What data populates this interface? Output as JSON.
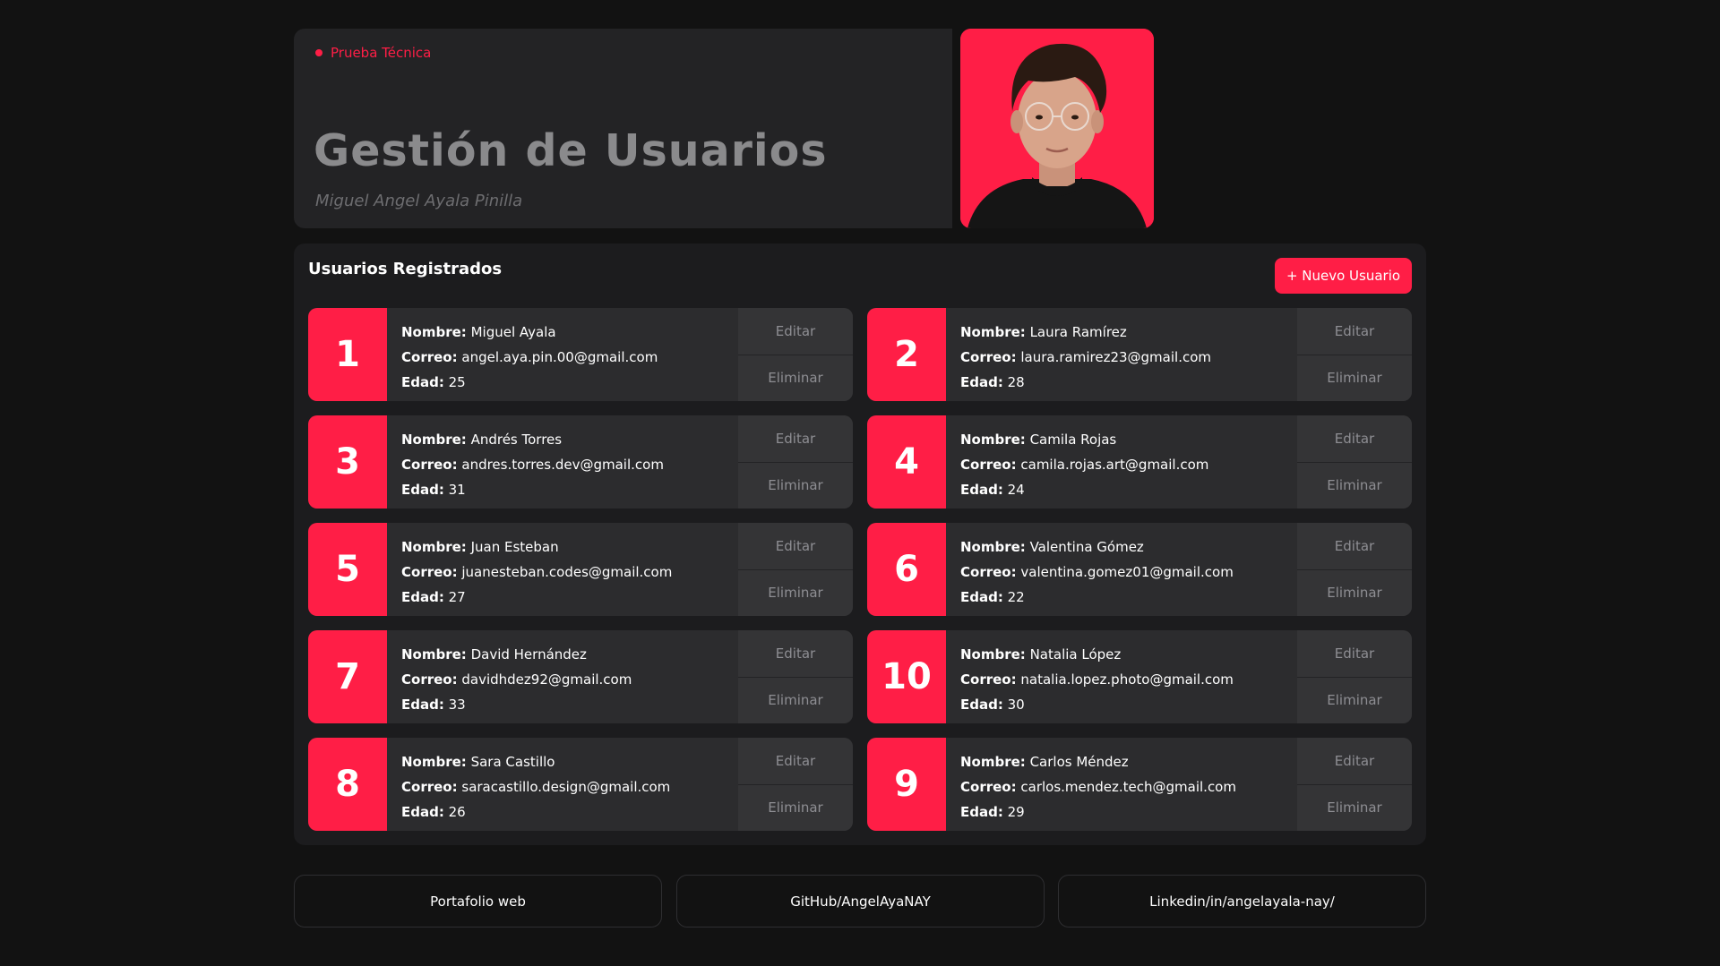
{
  "header": {
    "tag": "Prueba Técnica",
    "title": "Gestión de Usuarios",
    "author": "Miguel Angel Ayala Pinilla"
  },
  "panel": {
    "title": "Usuarios Registrados",
    "new_user_label": "+ Nuevo Usuario"
  },
  "labels": {
    "name": "Nombre:",
    "email": "Correo:",
    "age": "Edad:",
    "edit": "Editar",
    "delete": "Eliminar"
  },
  "users": [
    {
      "num": "1",
      "name": "Miguel Ayala",
      "email": "angel.aya.pin.00@gmail.com",
      "age": "25"
    },
    {
      "num": "2",
      "name": "Laura Ramírez",
      "email": "laura.ramirez23@gmail.com",
      "age": "28"
    },
    {
      "num": "3",
      "name": "Andrés Torres",
      "email": "andres.torres.dev@gmail.com",
      "age": "31"
    },
    {
      "num": "4",
      "name": "Camila Rojas",
      "email": "camila.rojas.art@gmail.com",
      "age": "24"
    },
    {
      "num": "5",
      "name": "Juan Esteban",
      "email": "juanesteban.codes@gmail.com",
      "age": "27"
    },
    {
      "num": "6",
      "name": "Valentina Gómez",
      "email": "valentina.gomez01@gmail.com",
      "age": "22"
    },
    {
      "num": "7",
      "name": "David Hernández",
      "email": "davidhdez92@gmail.com",
      "age": "33"
    },
    {
      "num": "10",
      "name": "Natalia López",
      "email": "natalia.lopez.photo@gmail.com",
      "age": "30"
    },
    {
      "num": "8",
      "name": "Sara Castillo",
      "email": "saracastillo.design@gmail.com",
      "age": "26"
    },
    {
      "num": "9",
      "name": "Carlos Méndez",
      "email": "carlos.mendez.tech@gmail.com",
      "age": "29"
    }
  ],
  "footer": {
    "links": [
      "Portafolio web",
      "GitHub/AngelAyaNAY",
      "Linkedin/in/angelayala-nay/"
    ]
  },
  "colors": {
    "accent": "#ff1e46",
    "background": "#121212",
    "card": "#2c2c2e"
  }
}
